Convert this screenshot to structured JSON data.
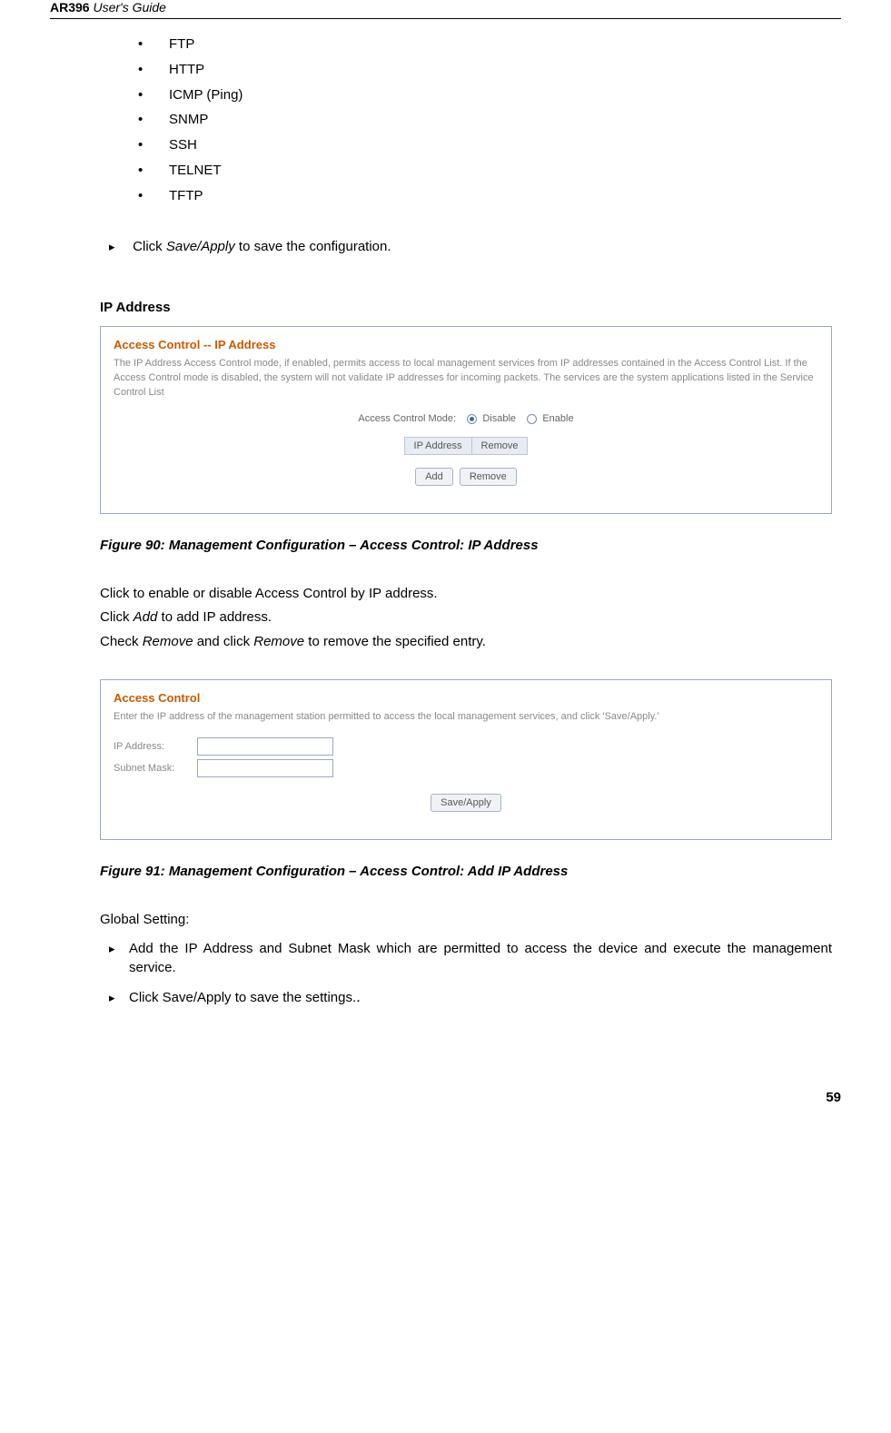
{
  "header": {
    "bold": "AR396",
    "italic": " User's Guide"
  },
  "protocols": [
    "FTP",
    "HTTP",
    "ICMP (Ping)",
    "SNMP",
    "SSH",
    "TELNET",
    "TFTP"
  ],
  "saveApplyNote": {
    "pre": "Click ",
    "mid": "Save/Apply",
    "post": " to save the configuration."
  },
  "ipAddressHeading": "IP Address",
  "fig90": {
    "title": "Access Control -- IP Address",
    "desc": "The IP Address Access Control mode, if enabled, permits access to local management services from IP addresses contained in the Access Control List. If the Access Control mode is disabled, the system will not validate IP addresses for incoming packets. The services are the system applications listed in the Service Control List",
    "modeLabel": "Access Control Mode:",
    "disable": "Disable",
    "enable": "Enable",
    "colIp": "IP Address",
    "colRemove": "Remove",
    "btnAdd": "Add",
    "btnRemove": "Remove"
  },
  "caption90": "Figure 90: Management Configuration – Access Control: IP Address",
  "body": {
    "l1": "Click to enable or disable Access Control by IP address.",
    "l2pre": "Click ",
    "l2mid": "Add",
    "l2post": " to add IP address.",
    "l3pre": "Check ",
    "l3mid1": "Remove",
    "l3mid2": " and click ",
    "l3mid3": "Remove",
    "l3post": " to remove the specified entry."
  },
  "fig91": {
    "title": "Access Control",
    "desc": "Enter the IP address of the management station permitted to access the local management services, and click 'Save/Apply.'",
    "ipLabel": "IP Address:",
    "maskLabel": "Subnet Mask:",
    "btn": "Save/Apply"
  },
  "caption91": "Figure 91: Management Configuration – Access Control: Add IP Address",
  "globalHeading": "Global Setting:",
  "global": {
    "a1": "Add the IP Address and Subnet Mask which are permitted to access the device and execute the management service.",
    "a2": "Click Save/Apply to save the settings."
  },
  "pageNum": "59"
}
